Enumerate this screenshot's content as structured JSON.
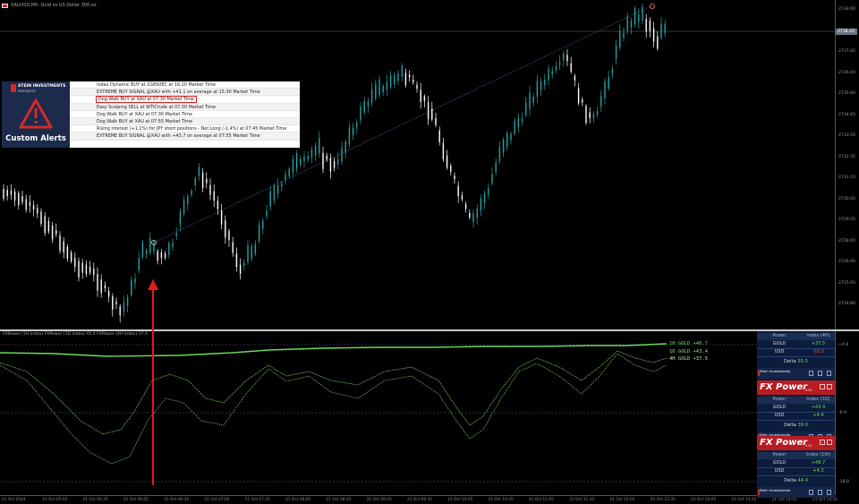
{
  "window": {
    "title": "XAUUSD,M5: Gold vs US Dollar 300 oz."
  },
  "price_axis": {
    "labels": [
      "2739.90",
      "2738.00",
      "2737.05",
      "2736.00",
      "2735.80",
      "2734.65",
      "2733.50",
      "2732.35",
      "2731.10",
      "2730.05",
      "2729.05",
      "2728.00",
      "2726.90",
      "2725.95",
      "2724.80"
    ],
    "current_price": "2738.20"
  },
  "indicator_axis": {
    "labels": [
      "+4.8",
      "-6.9",
      "-18.8"
    ]
  },
  "time_axis": {
    "labels": [
      "21 Oct 2024",
      "21 Oct 05:05",
      "21 Oct 05:35",
      "21 Oct 06:05",
      "21 Oct 06:35",
      "21 Oct 07:05",
      "21 Oct 07:35",
      "21 Oct 08:05",
      "21 Oct 08:35",
      "21 Oct 09:05",
      "21 Oct 09:35",
      "21 Oct 10:05",
      "21 Oct 10:35",
      "21 Oct 11:05",
      "21 Oct 11:35",
      "21 Oct 12:05",
      "21 Oct 12:35",
      "21 Oct 13:05",
      "21 Oct 13:35",
      "21 Oct 14:05",
      "21 Oct 14:35"
    ]
  },
  "indicator": {
    "header": "FXPower (1H Index) FXPower (1D Index) 45.4 FXPower (4H Index) 37.5",
    "legend": [
      {
        "text": "1H  GOLD +40.7",
        "color": "#6bdc58"
      },
      {
        "text": "1D  GOLD +43.4",
        "color": "#9bdc80"
      },
      {
        "text": "4H  GOLD +37.5",
        "color": "#c8e6a0"
      }
    ]
  },
  "alert_panel": {
    "brand_name": "STEIN INVESTMENTS",
    "brand_sub": "PRESENTS",
    "title": "Custom Alerts",
    "rows": [
      "Index Dynamic BUY at 1G8S0EC at 16:20 Market Time",
      "EXTREME BUY SIGNAL @XAU with +41.1 on average at 15:30 Market Time",
      "Dog Walk BUY at XAU at 07:30 Market Time",
      "Easy Scalping SELL at WTICrude at 07:30 Market Time",
      "Dog Walk BUY at XAU at 07:30 Market Time",
      "Dog Walk BUY at XAU at 07:55 Market Time",
      "Rising interest (+1.1%) for JPY short positions - Net Long (-1.4%) at 07:45 Market Time",
      "EXTREME BUY SIGNAL @XAU with +43.7 on average at 07:55 Market Time"
    ]
  },
  "fx_power": {
    "panels": [
      {
        "col1": "Power",
        "col2": "Index (4H)",
        "rows": [
          {
            "k": "GOLD",
            "v": "+37.5",
            "dir": "up"
          },
          {
            "k": "USD",
            "v": "-18.0",
            "dir": "dn"
          }
        ],
        "delta_label": "Delta",
        "delta": "55.5"
      },
      {
        "col1": "Power",
        "col2": "Index (1D)",
        "rows": [
          {
            "k": "GOLD",
            "v": "+43.4",
            "dir": "up"
          },
          {
            "k": "USD",
            "v": "+4.4",
            "dir": "up"
          }
        ],
        "delta_label": "Delta",
        "delta": "39.0"
      },
      {
        "col1": "Power",
        "col2": "Index (1W)",
        "rows": [
          {
            "k": "GOLD",
            "v": "+48.7",
            "dir": "up"
          },
          {
            "k": "USD",
            "v": "+4.3",
            "dir": "up"
          }
        ],
        "delta_label": "Delta",
        "delta": "44.4"
      }
    ],
    "brand": "Stein Investments",
    "banner": "FX Power",
    "version": "4.42"
  },
  "colors": {
    "bull_candle": "#29a3a3",
    "bear_candle": "#ffffff",
    "power_1h": "#6bdc58",
    "arrow": "#e21b1b",
    "fx_background": "#0c1c3c"
  }
}
